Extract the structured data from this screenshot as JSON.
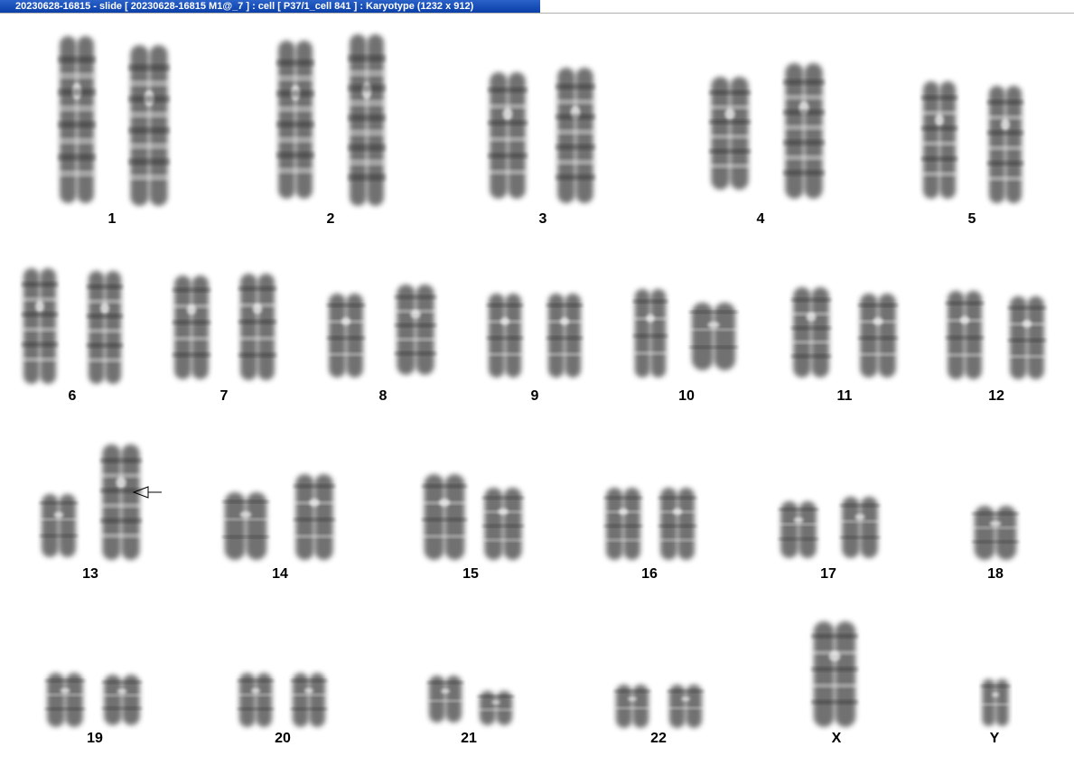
{
  "window": {
    "title": "20230628-16815 - slide [ 20230628-16815 M1@_7 ] : cell [ P37/1_cell 841 ] : Karyotype  (1232 x 912)"
  },
  "colors": {
    "titlebar": "#0a3fa8",
    "chromosome": "#3a3a3a",
    "background": "#ffffff"
  },
  "karyotype": {
    "labels": [
      "1",
      "2",
      "3",
      "4",
      "5",
      "6",
      "7",
      "8",
      "9",
      "10",
      "11",
      "12",
      "13",
      "14",
      "15",
      "16",
      "17",
      "18",
      "19",
      "20",
      "21",
      "22",
      "X",
      "Y"
    ],
    "annotation": "arrow-icon"
  }
}
